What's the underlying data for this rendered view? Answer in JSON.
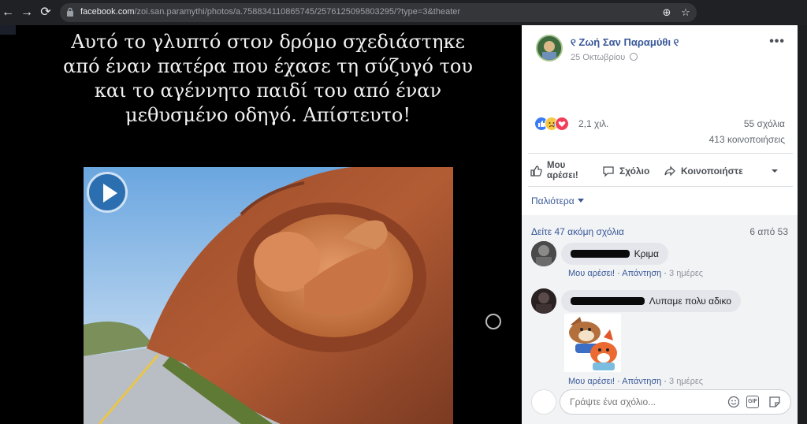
{
  "browser": {
    "back_glyph": "←",
    "forward_glyph": "→",
    "reload_glyph": "⟳",
    "url_host": "facebook.com",
    "url_path": "/zoi.san.paramythi/photos/a.758834110865745/2576125095803295/?type=3&theater",
    "zoom_glyph": "⊕",
    "star_glyph": "☆"
  },
  "photo": {
    "caption": "Αυτό το γλυπτό στον δρόμο σχεδιάστηκε από έναν πατέρα που έχασε τη σύζυγό του και το αγέννητο παιδί του από έναν μεθυσμένο οδηγό. Απίστευτο!"
  },
  "post": {
    "page_name": "୧ Ζωή Σαν Παραμύθι ୧",
    "date": "25 Οκτωβρίου",
    "more_glyph": "•••",
    "reaction_count": "2,1 χιλ.",
    "comments_count": "55 σχόλια",
    "shares_count": "413 κοινοποιήσεις",
    "actions": {
      "like_line1": "Μου",
      "like_line2": "αρέσει!",
      "comment": "Σχόλιο",
      "share": "Κοινοποιήστε"
    },
    "sort_label": "Παλιότερα",
    "view_more": "Δείτε 47 ακόμη σχόλια",
    "page_count": "6 από 53"
  },
  "comments": [
    {
      "text": "Κριμα",
      "like": "Μου αρέσει!",
      "reply": "Απάντηση",
      "time": "3 ημέρες"
    },
    {
      "text": "Λυπαμε πολυ αδικο",
      "like": "Μου αρέσει!",
      "reply": "Απάντηση",
      "time": "3 ημέρες"
    }
  ],
  "composer": {
    "placeholder": "Γράψτε ένα σχόλιο...",
    "gif_label": "GIF"
  },
  "colors": {
    "link": "#385898",
    "like_blue": "#3b7cf6",
    "love_red": "#f33e58",
    "sad_yellow": "#f7c845"
  }
}
